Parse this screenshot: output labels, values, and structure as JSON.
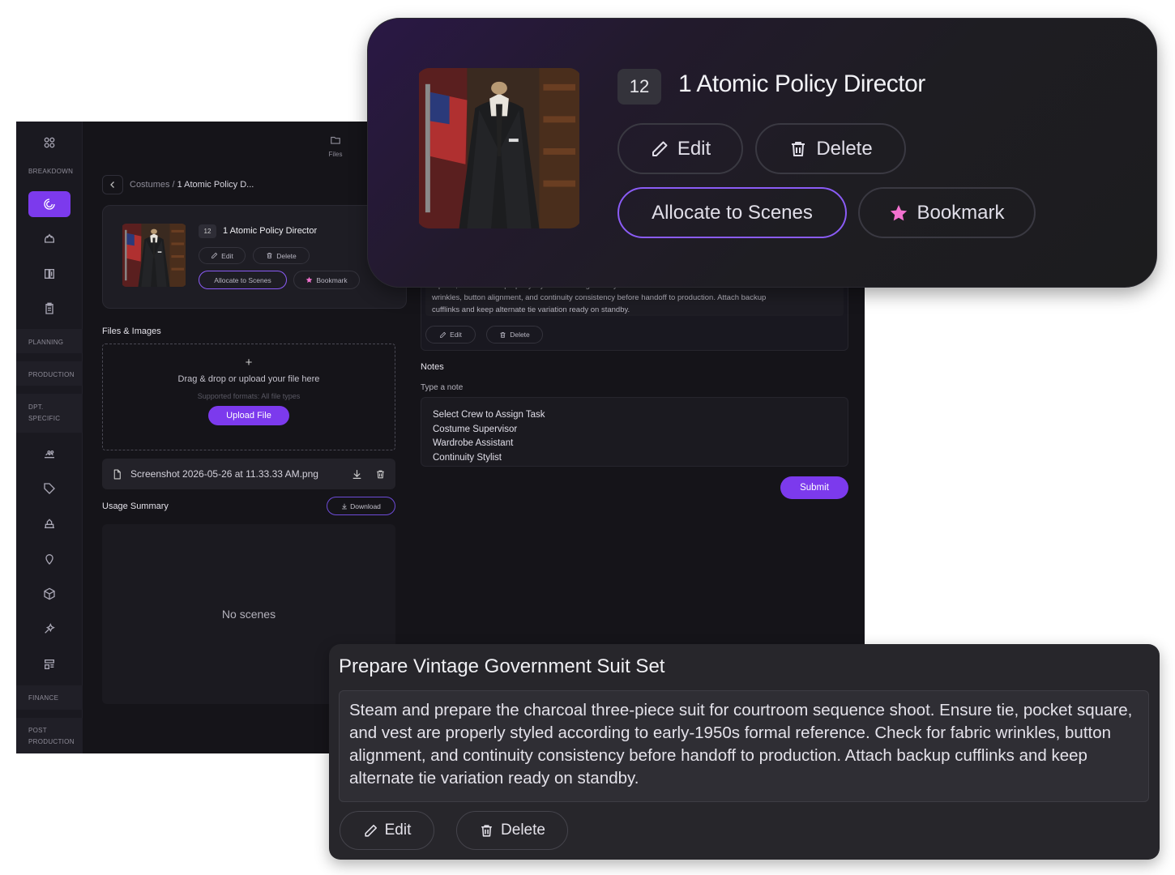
{
  "sidebar": {
    "labels": [
      "BREAKDOWN",
      "PLANNING",
      "PRODUCTION",
      "DPT.",
      "SPECIFIC",
      "FINANCE",
      "POST",
      "PRODUCTION"
    ],
    "accent": "#7c3aed"
  },
  "header": {
    "files_tab": "Files"
  },
  "breadcrumb": {
    "parent": "Costumes",
    "separator": "/",
    "current": "1 Atomic Policy D..."
  },
  "item": {
    "number": "12",
    "title": "1 Atomic Policy Director",
    "edit_label": "Edit",
    "delete_label": "Delete",
    "allocate_label": "Allocate to Scenes",
    "bookmark_label": "Bookmark"
  },
  "files": {
    "section_title": "Files & Images",
    "plus": "+",
    "dropzone_text": "Drag & drop or upload your file here",
    "formats_text": "Supported formats: All file types",
    "upload_label": "Upload File",
    "file_name": "Screenshot 2026-05-26 at 11.33.33 AM.png"
  },
  "usage": {
    "title": "Usage Summary",
    "download_label": "Download",
    "empty_text": "No scenes"
  },
  "task": {
    "title": "Prepare Vintage Government Suit Set",
    "description": "Steam and prepare the charcoal three-piece suit for courtroom sequence shoot. Ensure tie, pocket square, and vest are properly styled according to early-1950s formal reference. Check for fabric wrinkles, button alignment, and continuity consistency before handoff to production. Attach backup cufflinks and keep alternate tie variation ready on standby.",
    "fragment_line1": "square, and vest are properly styled according to early-1950s formal reference. Check for fabric",
    "fragment_line2": "wrinkles, button alignment, and continuity consistency before handoff to production. Attach backup",
    "fragment_line3": "cufflinks and keep alternate tie variation ready on standby.",
    "edit_label": "Edit",
    "delete_label": "Delete"
  },
  "notes": {
    "title": "Notes",
    "type_label": "Type a note",
    "lines": [
      "Select Crew to Assign Task",
      "Costume Supervisor",
      "Wardrobe Assistant",
      "Continuity Stylist"
    ],
    "submit_label": "Submit"
  }
}
